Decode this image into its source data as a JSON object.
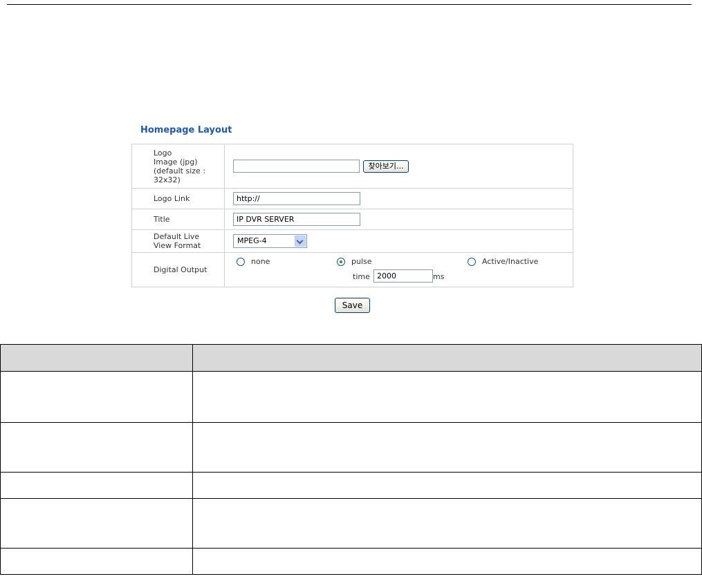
{
  "section_title": "Homepage Layout",
  "form": {
    "logo_image": {
      "label_lines": [
        "Logo",
        "Image (jpg)",
        "(default size :",
        "32x32)"
      ],
      "value": "",
      "browse_label": "찾아보기..."
    },
    "logo_link": {
      "label": "Logo Link",
      "value": "http://"
    },
    "title": {
      "label": "Title",
      "value": "IP DVR SERVER"
    },
    "live_view": {
      "label_lines": [
        "Default Live",
        "View Format"
      ],
      "selected": "MPEG-4"
    },
    "digital_output": {
      "label": "Digital Output",
      "options": [
        {
          "label": "none",
          "checked": false
        },
        {
          "label": "pulse",
          "checked": true
        },
        {
          "label": "Active/Inactive",
          "checked": false
        }
      ],
      "time_label": "time",
      "time_value": "2000",
      "time_unit": "ms"
    }
  },
  "save_label": "Save",
  "description_table": {
    "rows": 5
  }
}
